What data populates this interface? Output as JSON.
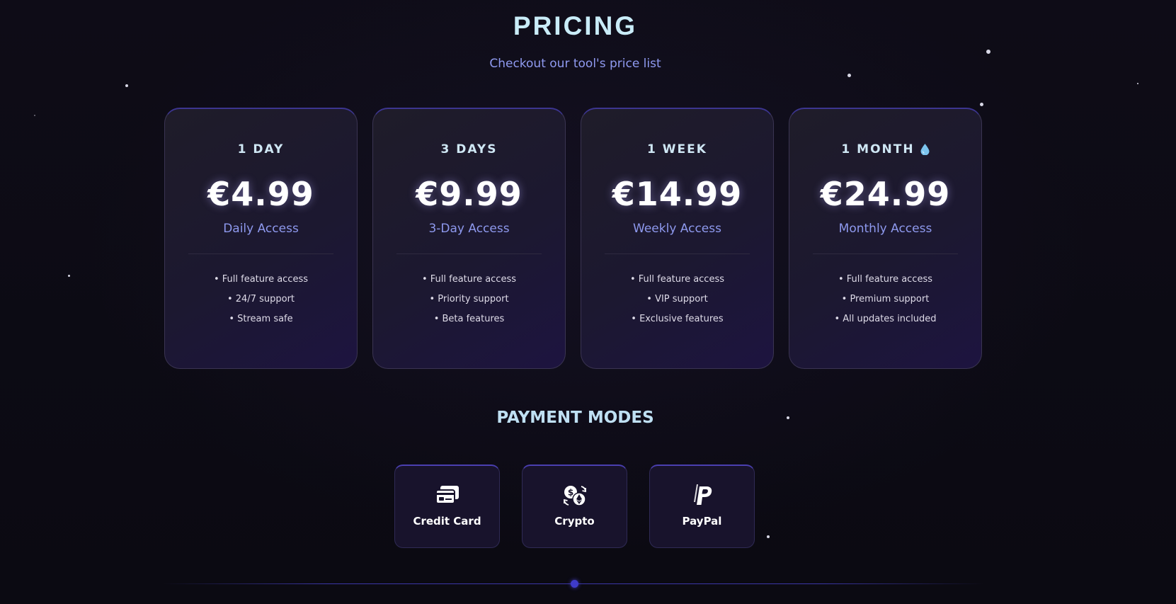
{
  "header": {
    "title": "PRICING",
    "subtitle": "Checkout our tool's price list"
  },
  "plans": [
    {
      "name": "1 DAY",
      "price": "€4.99",
      "description": "Daily Access",
      "features": [
        "• Full feature access",
        "• 24/7 support",
        "• Stream safe"
      ]
    },
    {
      "name": "3 DAYS",
      "price": "€9.99",
      "description": "3-Day Access",
      "features": [
        "• Full feature access",
        "• Priority support",
        "• Beta features"
      ]
    },
    {
      "name": "1 WEEK",
      "price": "€14.99",
      "description": "Weekly Access",
      "features": [
        "• Full feature access",
        "• VIP support",
        "• Exclusive features"
      ]
    },
    {
      "name": "1 MONTH",
      "name_icon": "droplet-icon",
      "price": "€24.99",
      "description": "Monthly Access",
      "features": [
        "• Full feature access",
        "• Premium support",
        "• All updates included"
      ]
    }
  ],
  "payment": {
    "title": "PAYMENT MODES",
    "methods": [
      {
        "label": "Credit Card",
        "icon": "credit-card-icon"
      },
      {
        "label": "Crypto",
        "icon": "crypto-exchange-icon"
      },
      {
        "label": "PayPal",
        "icon": "paypal-icon"
      }
    ]
  },
  "colors": {
    "background": "#0c0b14",
    "title": "#c9ecf8",
    "accent": "#8e99ee",
    "card_border_top": "#3c3590",
    "droplet": "#7cc4ee"
  }
}
